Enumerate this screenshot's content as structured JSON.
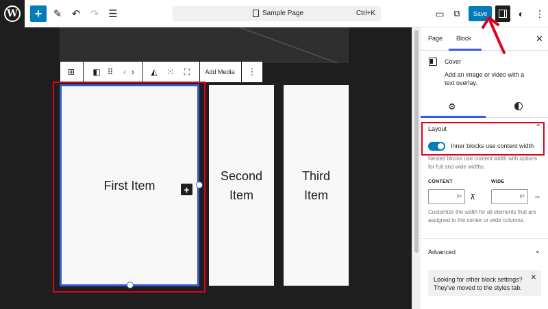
{
  "header": {
    "document_title": "Sample Page",
    "shortcut": "Ctrl+K",
    "save_label": "Save"
  },
  "block_toolbar": {
    "add_media_label": "Add Media"
  },
  "canvas": {
    "covers": [
      {
        "label": "First Item"
      },
      {
        "label": "Second Item"
      },
      {
        "label": "Third Item"
      }
    ]
  },
  "sidebar": {
    "tabs": [
      {
        "label": "Page"
      },
      {
        "label": "Block"
      }
    ],
    "active_tab": "Block",
    "block_card": {
      "title": "Cover",
      "description": "Add an image or video with a text overlay."
    },
    "layout": {
      "heading": "Layout",
      "toggle_label": "Inner blocks use content width",
      "toggle_on": true,
      "help": "Nested blocks use content width with options for full and wide widths.",
      "content_label": "CONTENT",
      "wide_label": "WIDE",
      "unit": "px",
      "width_help": "Customize the width for all elements that are assigned to the center or wide columns."
    },
    "advanced_label": "Advanced",
    "notice": "Looking for other block settings? They've moved to the styles tab."
  },
  "colors": {
    "accent": "#007cba",
    "selection": "#3858e9",
    "annotation": "#e0001a"
  },
  "icons": [
    "wordpress-logo-icon",
    "plus-icon",
    "pencil-icon",
    "undo-icon",
    "redo-icon",
    "list-view-icon",
    "document-icon",
    "desktop-preview-icon",
    "external-link-icon",
    "settings-panel-icon",
    "styles-contrast-icon",
    "more-vertical-icon",
    "grid-icon",
    "cover-icon",
    "drag-handle-icon",
    "chevron-left-icon",
    "chevron-right-icon",
    "contrast-triangle-icon",
    "focal-point-icon",
    "fullscreen-icon",
    "close-icon",
    "gear-icon",
    "chevron-up-icon",
    "chevron-down-icon",
    "justify-center-icon",
    "justify-stretch-icon"
  ]
}
